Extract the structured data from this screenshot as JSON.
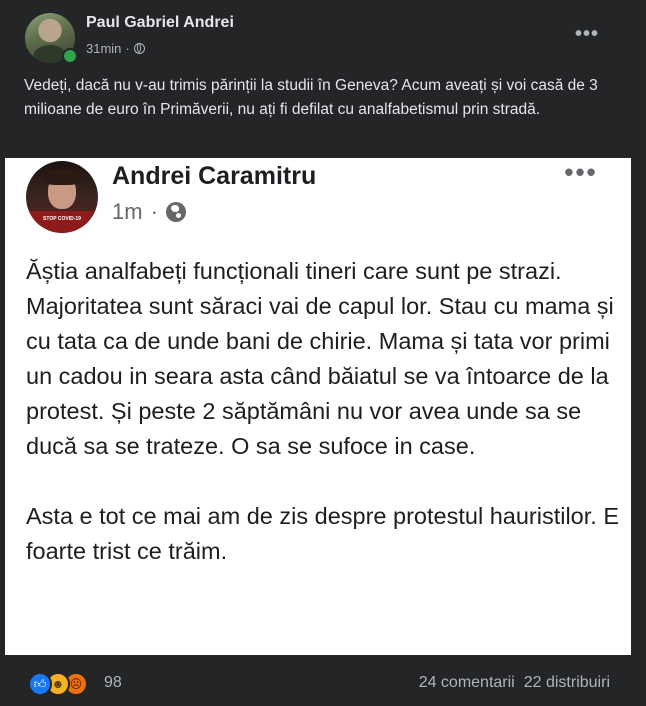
{
  "post": {
    "author": "Paul Gabriel Andrei",
    "time": "31min",
    "privacy_icon": "globe-icon",
    "more_icon": "more-horizontal-icon",
    "more_label": "•••",
    "caption": "Vedeți, dacă nu v-au trimis părinții la studii în Geneva? Acum aveați și voi casă de 3 milioane de euro în Primăverii, nu ați fi defilat cu analfabetismul prin stradă."
  },
  "shared_screenshot": {
    "author": "Andrei Caramitru",
    "time": "1m",
    "privacy_icon": "globe-icon",
    "more_label": "•••",
    "avatar_frame_text": "STOP COVID-19",
    "paragraphs": [
      "Ăștia analfabeți funcționali tineri care sunt pe strazi. Majoritatea sunt săraci vai de capul lor. Stau cu mama și cu tata ca de unde bani de chirie. Mama și tata vor primi un cadou in seara asta când băiatul se va întoarce de la protest. Și peste 2 săptămâni nu vor avea unde sa se ducă sa se trateze. O sa se sufoce in case.",
      "Asta e tot ce mai am de zis despre protestul hauristilor. E foarte trist ce trăim."
    ]
  },
  "footer": {
    "reactions": [
      "like",
      "haha",
      "angry"
    ],
    "reaction_count": "98",
    "comments": "24 comentarii",
    "shares": "22 distribuiri"
  },
  "colors": {
    "card_bg": "#242526",
    "text_primary": "#e4e6eb",
    "text_secondary": "#b0b3b8",
    "online": "#31a24c",
    "like_blue": "#1877f2"
  }
}
